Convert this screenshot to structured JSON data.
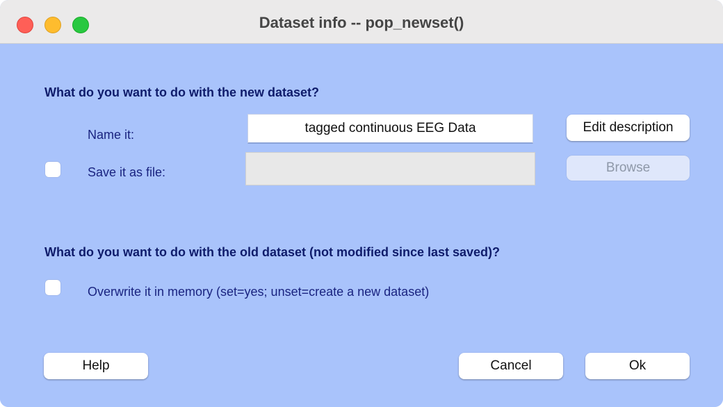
{
  "window": {
    "title": "Dataset info -- pop_newset()"
  },
  "new_dataset": {
    "heading": "What do you want to do with the new dataset?",
    "name_label": "Name it:",
    "name_value": "tagged continuous EEG Data",
    "edit_description_label": "Edit description",
    "save_label": "Save it as file:",
    "save_checked": false,
    "save_path_value": "",
    "browse_label": "Browse"
  },
  "old_dataset": {
    "heading": "What do you want to do with the old dataset (not modified since last saved)?",
    "overwrite_label": "Overwrite it in memory (set=yes; unset=create a new dataset)",
    "overwrite_checked": false
  },
  "footer": {
    "help_label": "Help",
    "cancel_label": "Cancel",
    "ok_label": "Ok"
  },
  "colors": {
    "background": "#a9c3fb",
    "heading_text": "#0f1c6b",
    "label_text": "#1a2480"
  }
}
